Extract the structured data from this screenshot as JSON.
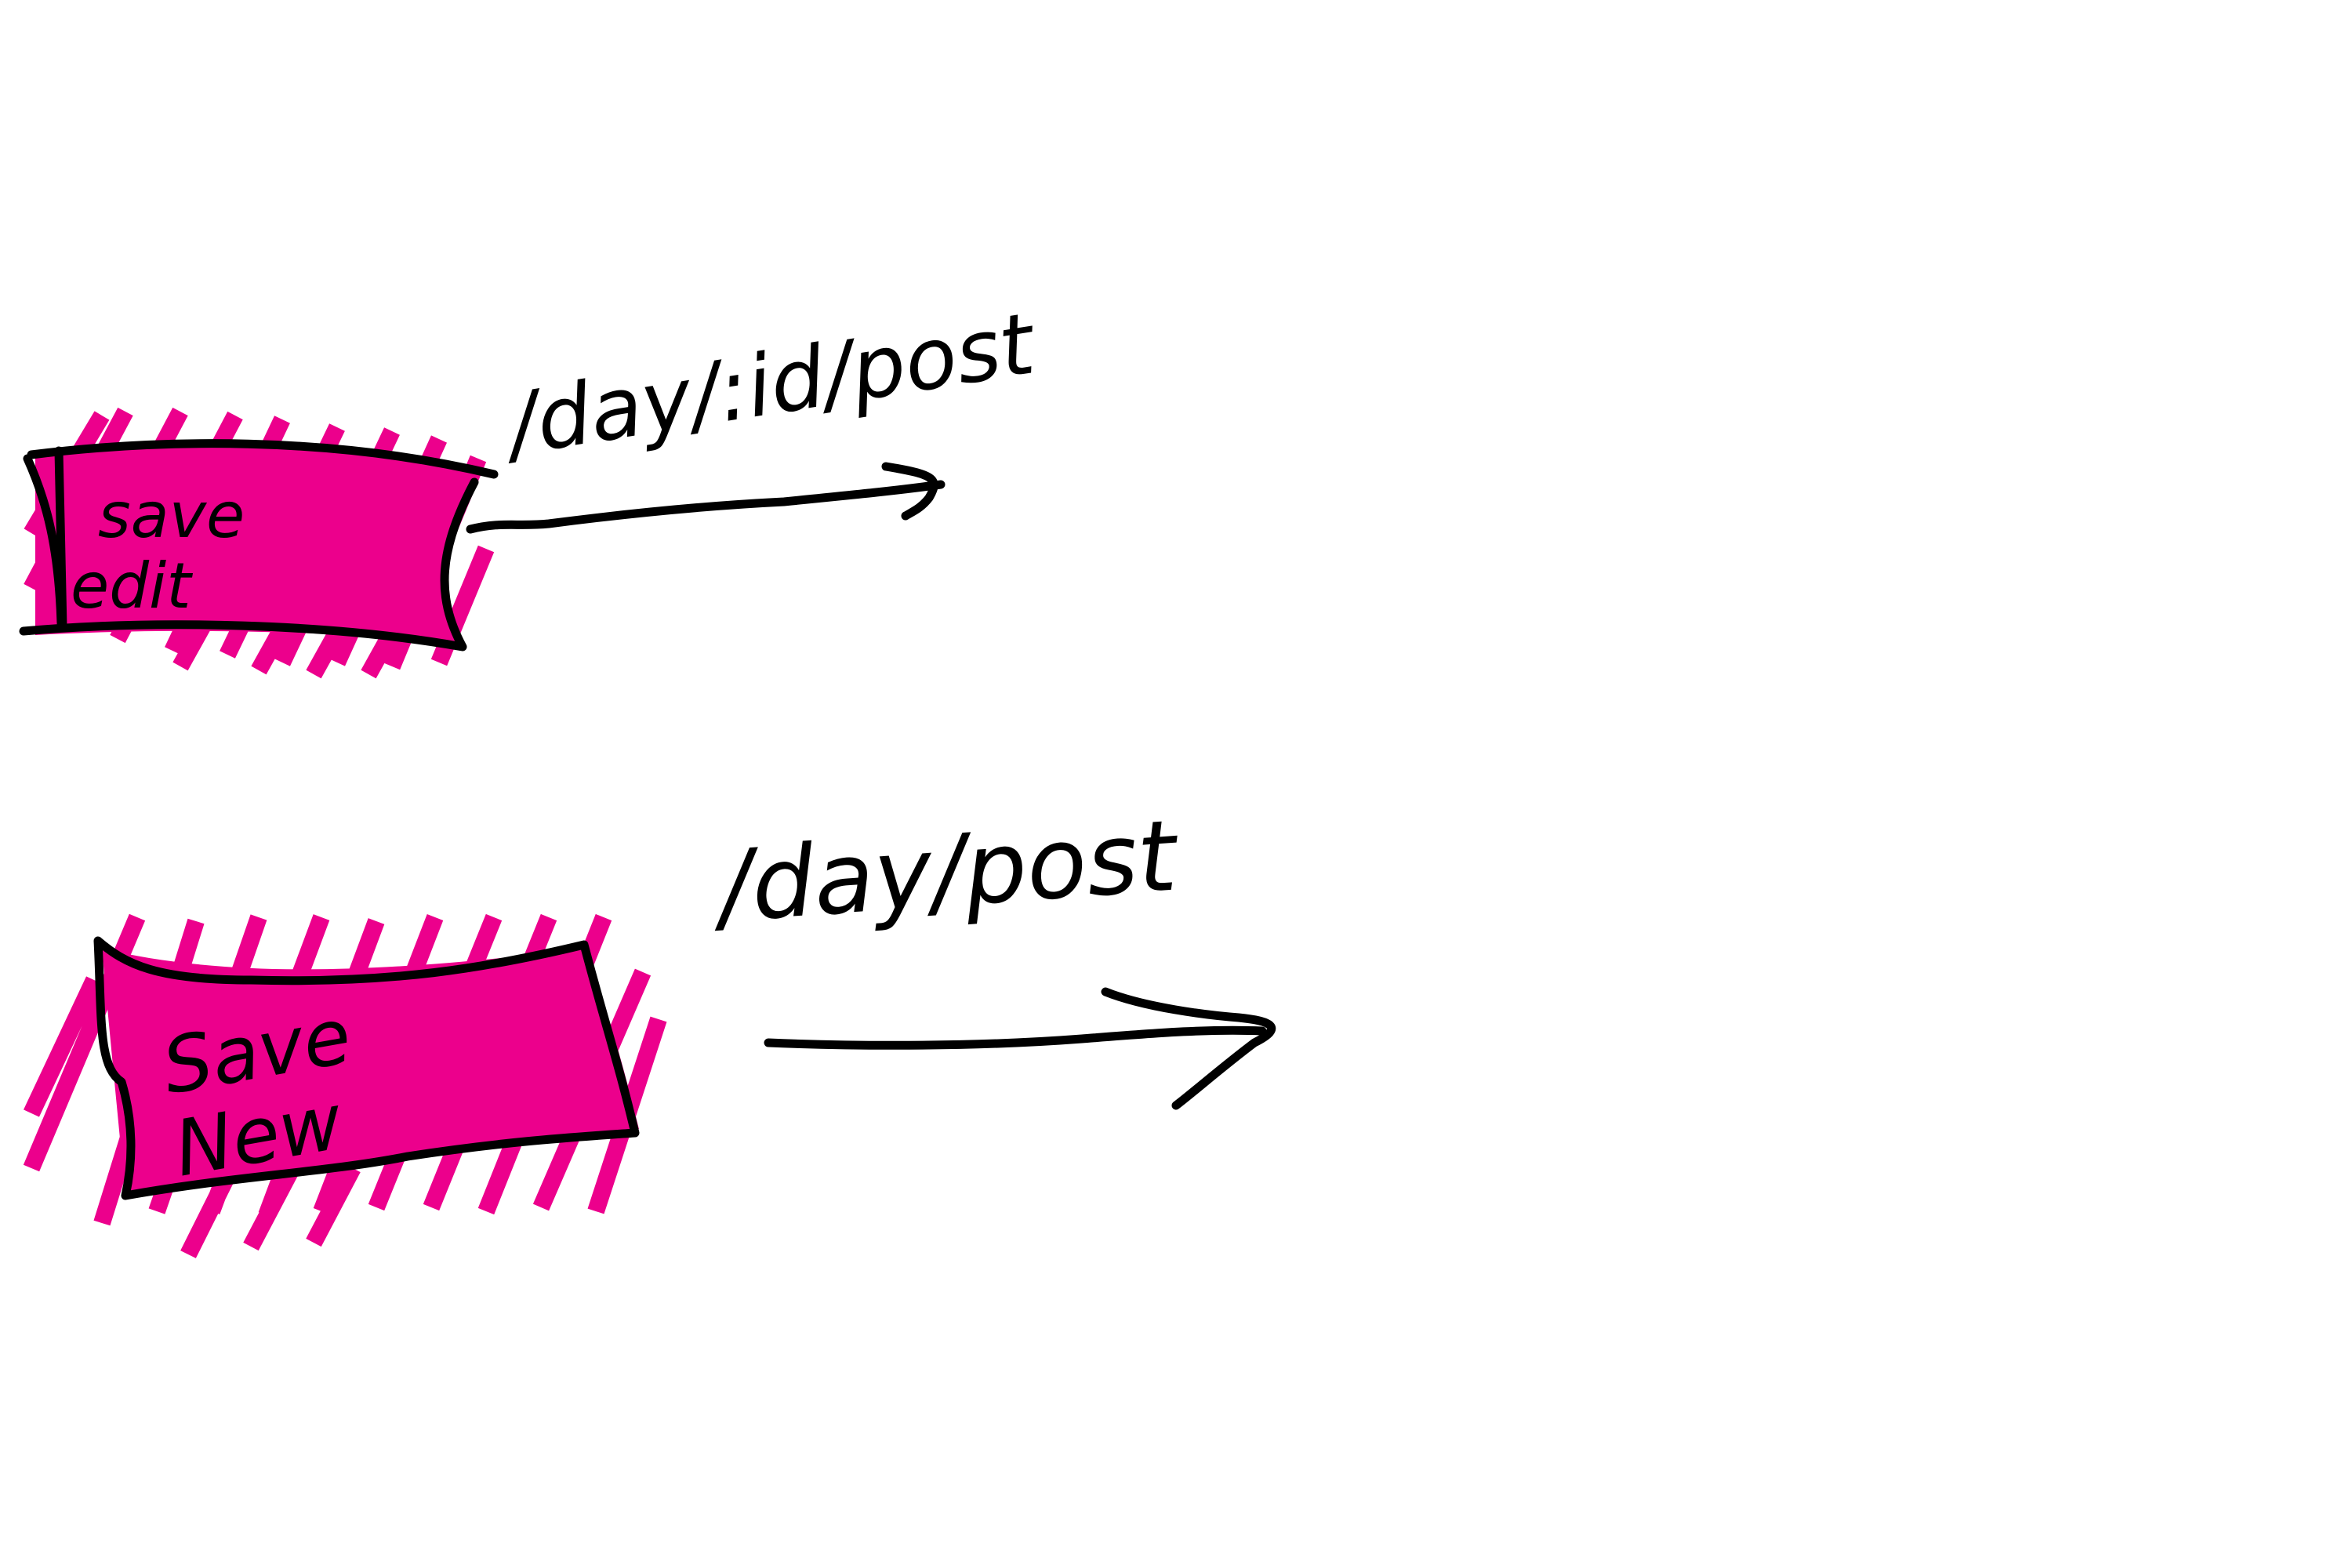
{
  "colors": {
    "highlight": "#EC008C",
    "ink": "#000000",
    "background": "#FFFFFF"
  },
  "buttons": [
    {
      "line1": "save",
      "line2": "edit"
    },
    {
      "line1": "Save",
      "line2": "New"
    }
  ],
  "routes": [
    {
      "label": "/day/:id/post"
    },
    {
      "label": "/day/post"
    }
  ]
}
